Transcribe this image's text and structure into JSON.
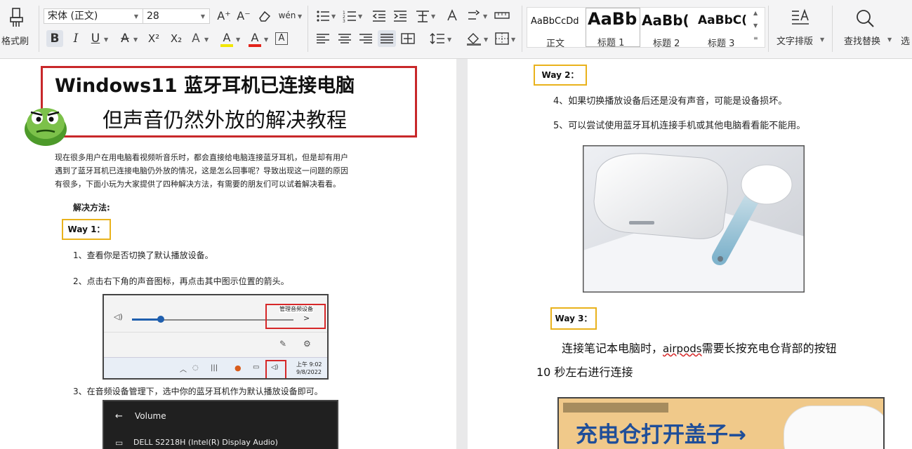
{
  "toolbar": {
    "format_painter_label": "格式刷",
    "font_name": "宋体 (正文)",
    "font_size": "28",
    "grow_font_icon": "A⁺",
    "shrink_font_icon": "A⁻",
    "pinyin_icon": "wén",
    "bold": "B",
    "italic": "I",
    "underline": "U",
    "strike": "A",
    "superscript": "X²",
    "subscript": "X₂",
    "text_effect": "A",
    "highlight": "A",
    "font_color": "A",
    "char_border": "A",
    "styles": [
      {
        "preview": "AaBbCcDd",
        "name": "正文"
      },
      {
        "preview": "AaBb",
        "name": "标题 1"
      },
      {
        "preview": "AaBb(",
        "name": "标题 2"
      },
      {
        "preview": "AaBbC(",
        "name": "标题 3"
      }
    ],
    "text_layout_label": "文字排版",
    "find_replace_label": "查找替换",
    "select_label": "选"
  },
  "left_page": {
    "title_line1": "Windows11 蓝牙耳机已连接电脑",
    "title_line2": "但声音仍然外放的解决教程",
    "intro_lines": [
      "现在很多用户在用电脑看视频听音乐时，都会直接给电脑连接蓝牙耳机，但是却有用户",
      "遇到了蓝牙耳机已连接电脑仍外放的情况，这是怎么回事呢？导致出现这一问题的原因",
      "有很多，下面小玩为大家提供了四种解决方法，有需要的朋友们可以试着解决看看。"
    ],
    "solution_heading": "解决方法:",
    "way1": "Way 1：",
    "step1": "1、查看你是否切换了默认播放设备。",
    "step2": "2、点击右下角的声音图标，再点击其中图示位置的箭头。",
    "screenshot1": {
      "manage_label": "管理音频设备",
      "time": "上午 9:02",
      "date": "9/8/2022"
    },
    "step3": "3、在音频设备管理下，选中你的蓝牙耳机作为默认播放设备即可。",
    "screenshot2": {
      "heading": "Volume",
      "device": "DELL S2218H (Intel(R) Display Audio)"
    }
  },
  "right_page": {
    "way2": "Way 2：",
    "step4": "4、如果切换播放设备后还是没有声音，可能是设备损坏。",
    "step5": "5、可以尝试使用蓝牙耳机连接手机或其他电脑看看能不能用。",
    "way3": "Way 3：",
    "para_line1_a": "连接笔记本电脑时，",
    "para_line1_b": "airpods",
    "para_line1_c": "需要长按充电仓背部的按钮",
    "para_line2": "10 秒左右进行连接",
    "banner_text": "充电仓打开盖子→"
  }
}
